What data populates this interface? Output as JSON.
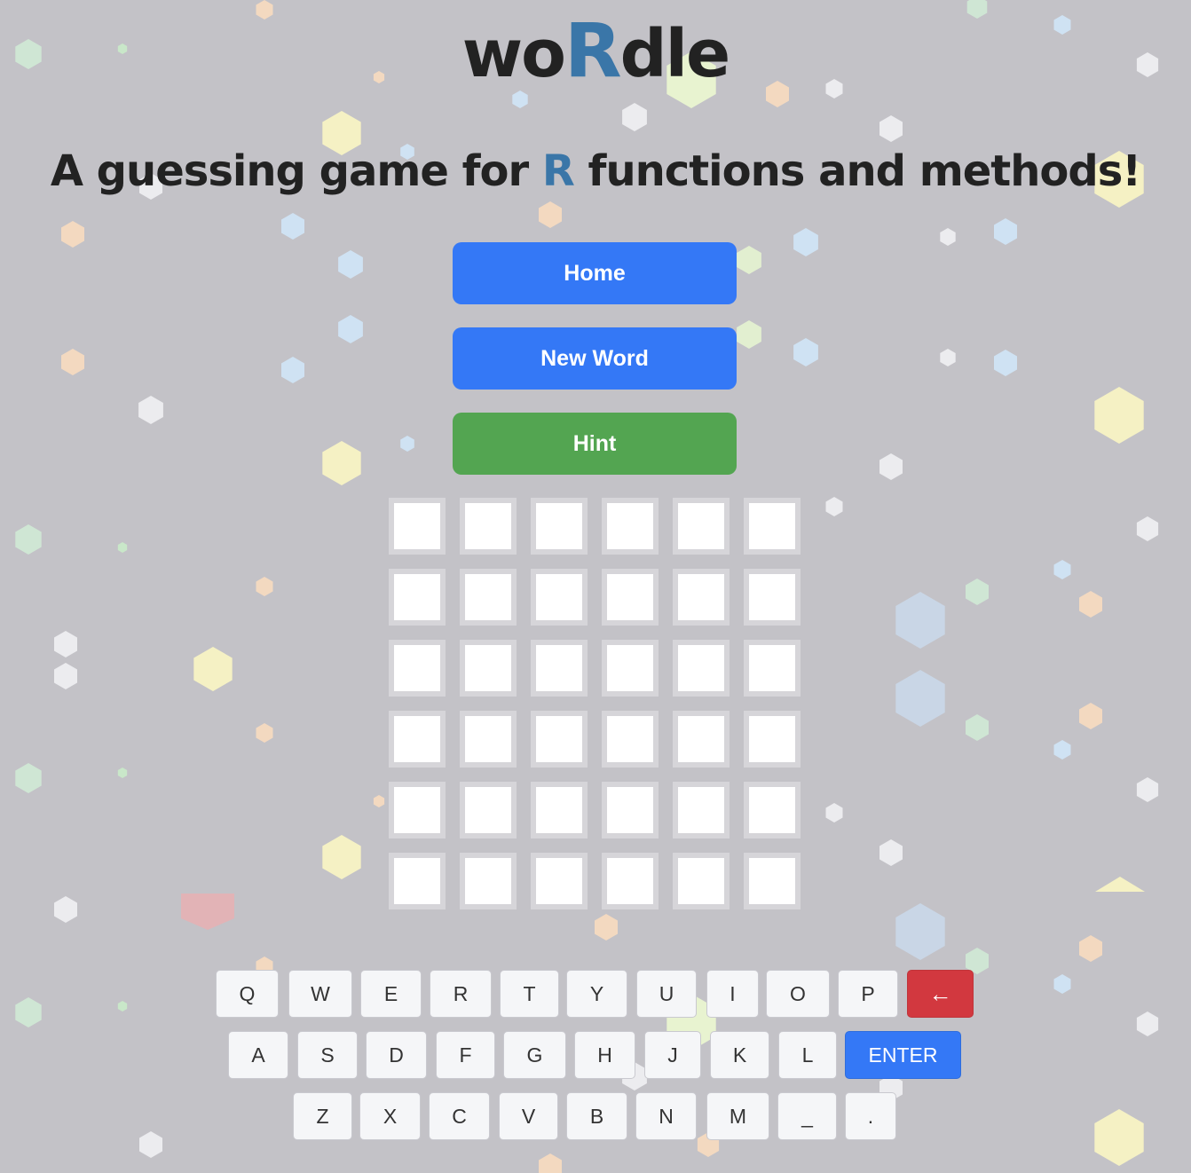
{
  "header": {
    "logo_prefix": "wo",
    "logo_accent": "R",
    "logo_suffix": "dle",
    "tagline_prefix": "A guessing game for ",
    "tagline_accent": "R",
    "tagline_suffix": " functions and methods!"
  },
  "buttons": {
    "home": "Home",
    "new_word": "New Word",
    "hint": "Hint"
  },
  "board": {
    "rows": 6,
    "cols": 6,
    "letters": [
      [
        "",
        "",
        "",
        "",
        "",
        ""
      ],
      [
        "",
        "",
        "",
        "",
        "",
        ""
      ],
      [
        "",
        "",
        "",
        "",
        "",
        ""
      ],
      [
        "",
        "",
        "",
        "",
        "",
        ""
      ],
      [
        "",
        "",
        "",
        "",
        "",
        ""
      ],
      [
        "",
        "",
        "",
        "",
        "",
        ""
      ]
    ]
  },
  "keyboard": {
    "row1": [
      "Q",
      "W",
      "E",
      "R",
      "T",
      "Y",
      "U",
      "I",
      "O",
      "P",
      "←"
    ],
    "row2": [
      "A",
      "S",
      "D",
      "F",
      "G",
      "H",
      "J",
      "K",
      "L",
      "ENTER"
    ],
    "row3": [
      "Z",
      "X",
      "C",
      "V",
      "B",
      "N",
      "M",
      "_",
      "."
    ]
  },
  "colors": {
    "background": "#c3c2c7",
    "accent": "#3a76a8",
    "primary_button": "#3478f6",
    "hint_button": "#53a551",
    "backspace_key": "#d2383f"
  }
}
